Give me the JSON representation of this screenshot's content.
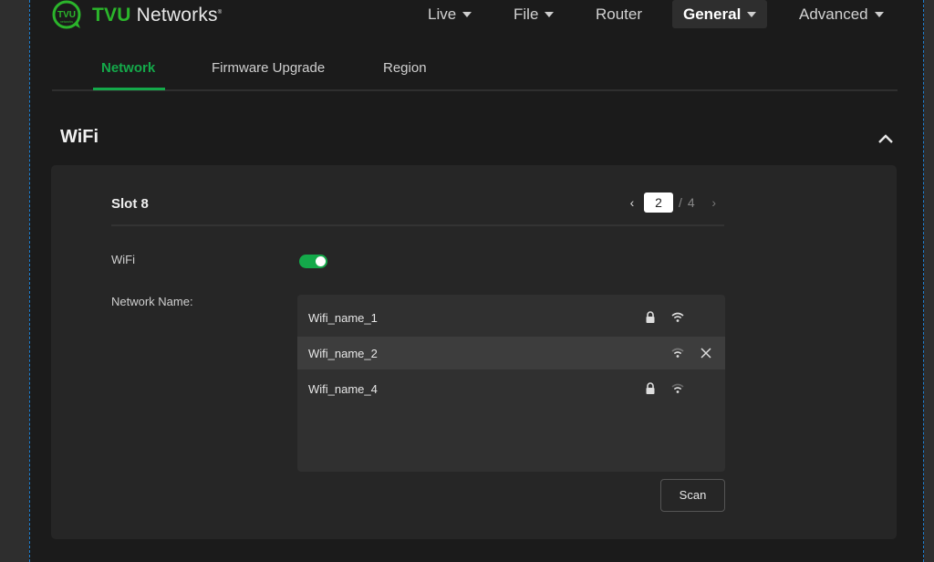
{
  "header": {
    "brand_bold": "TVU",
    "brand_rest": " Networks",
    "brand_mark_text": "TVU",
    "brand_mark_sub": "networks",
    "nav": [
      {
        "label": "Live",
        "has_caret": true,
        "active": false
      },
      {
        "label": "File",
        "has_caret": true,
        "active": false
      },
      {
        "label": "Router",
        "has_caret": false,
        "active": false
      },
      {
        "label": "General",
        "has_caret": true,
        "active": true
      },
      {
        "label": "Advanced",
        "has_caret": true,
        "active": false
      }
    ]
  },
  "tabs": [
    {
      "label": "Network",
      "active": true
    },
    {
      "label": "Firmware Upgrade",
      "active": false
    },
    {
      "label": "Region",
      "active": false
    }
  ],
  "section": {
    "title": "WiFi",
    "collapse_icon": "chevron-up-icon"
  },
  "slot": {
    "title": "Slot 8",
    "pager": {
      "current": "2",
      "separator": "/",
      "total": "4"
    }
  },
  "form": {
    "wifi_label": "WiFi",
    "wifi_enabled": true,
    "network_name_label": "Network Name:",
    "networks": [
      {
        "name": "Wifi_name_1",
        "locked": true,
        "signal_icon": "wifi-icon",
        "selected": false,
        "removable": false
      },
      {
        "name": "Wifi_name_2",
        "locked": false,
        "signal_icon": "wifi-icon",
        "selected": true,
        "removable": true
      },
      {
        "name": "Wifi_name_4",
        "locked": true,
        "signal_icon": "wifi-icon",
        "selected": false,
        "removable": false
      }
    ],
    "scan_label": "Scan"
  },
  "colors": {
    "accent": "#14a94a",
    "brand_green": "#2bb52b",
    "background": "#1b1b1b",
    "card": "#262626"
  }
}
